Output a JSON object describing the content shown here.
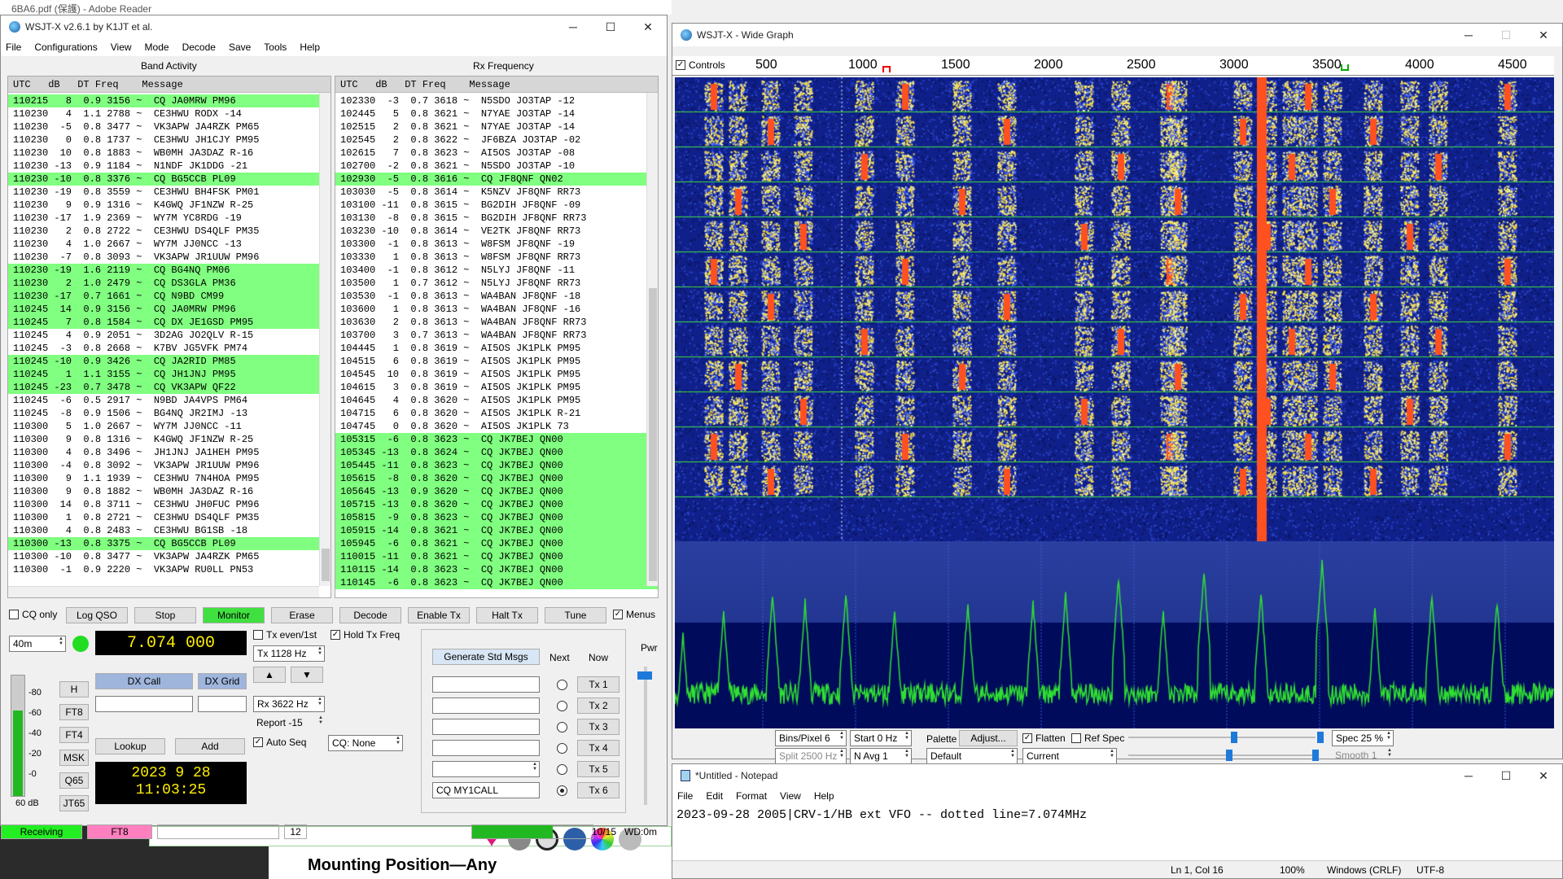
{
  "adobe": {
    "title": "6BA6.pdf (保護) - Adobe Reader",
    "pdf_text": "Mounting Position—Any"
  },
  "wsjtx": {
    "title": "WSJT-X   v2.6.1   by K1JT et al.",
    "menus": [
      "File",
      "Configurations",
      "View",
      "Mode",
      "Decode",
      "Save",
      "Tools",
      "Help"
    ],
    "band_activity_title": "Band Activity",
    "rx_frequency_title": "Rx Frequency",
    "col_header": "UTC   dB   DT Freq    Message",
    "band_activity_rows": [
      {
        "text": "110215   8  0.9 3156 ~  CQ JA0MRW PM96",
        "cq": true
      },
      {
        "text": "110230   4  1.1 2788 ~  CE3HWU RODX -14",
        "cq": false
      },
      {
        "text": "110230  -5  0.8 3477 ~  VK3APW JA4RZK PM65",
        "cq": false
      },
      {
        "text": "110230   0  0.8 1737 ~  CE3HWU JH1CJY PM95",
        "cq": false
      },
      {
        "text": "110230  10  0.8 1883 ~  WB0MH JA3DAZ R-16",
        "cq": false
      },
      {
        "text": "110230 -13  0.9 1184 ~  N1NDF JK1DDG -21",
        "cq": false
      },
      {
        "text": "110230 -10  0.8 3376 ~  CQ BG5CCB PL09",
        "cq": true
      },
      {
        "text": "110230 -19  0.8 3559 ~  CE3HWU BH4FSK PM01",
        "cq": false
      },
      {
        "text": "110230   9  0.9 1316 ~  K4GWQ JF1NZW R-25",
        "cq": false
      },
      {
        "text": "110230 -17  1.9 2369 ~  WY7M YC8RDG -19",
        "cq": false
      },
      {
        "text": "110230   2  0.8 2722 ~  CE3HWU DS4QLF PM35",
        "cq": false
      },
      {
        "text": "110230   4  1.0 2667 ~  WY7M JJ0NCC -13",
        "cq": false
      },
      {
        "text": "110230  -7  0.8 3093 ~  VK3APW JR1UUW PM96",
        "cq": false
      },
      {
        "text": "110230 -19  1.6 2119 ~  CQ BG4NQ PM06",
        "cq": true
      },
      {
        "text": "110230   2  1.0 2479 ~  CQ DS3GLA PM36",
        "cq": true
      },
      {
        "text": "110230 -17  0.7 1661 ~  CQ N9BD CM99",
        "cq": true
      },
      {
        "text": "110245  14  0.9 3156 ~  CQ JA0MRW PM96",
        "cq": true
      },
      {
        "text": "110245   7  0.8 1584 ~  CQ DX JE1GSD PM95",
        "cq": true
      },
      {
        "text": "110245   4  0.9 2051 ~  3D2AG JO2QLV R-15",
        "cq": false
      },
      {
        "text": "110245  -3  0.8 2668 ~  K7BV JG5VFK PM74",
        "cq": false
      },
      {
        "text": "110245 -10  0.9 3426 ~  CQ JA2RID PM85",
        "cq": true
      },
      {
        "text": "110245   1  1.1 3155 ~  CQ JH1JNJ PM95",
        "cq": true
      },
      {
        "text": "110245 -23  0.7 3478 ~  CQ VK3APW QF22",
        "cq": true
      },
      {
        "text": "110245  -6  0.5 2917 ~  N9BD JA4VPS PM64",
        "cq": false
      },
      {
        "text": "110245  -8  0.9 1506 ~  BG4NQ JR2IMJ -13",
        "cq": false
      },
      {
        "text": "110300   5  1.0 2667 ~  WY7M JJ0NCC -11",
        "cq": false
      },
      {
        "text": "110300   9  0.8 1316 ~  K4GWQ JF1NZW R-25",
        "cq": false
      },
      {
        "text": "110300   4  0.8 3496 ~  JH1JNJ JA1HEH PM95",
        "cq": false
      },
      {
        "text": "110300  -4  0.8 3092 ~  VK3APW JR1UUW PM96",
        "cq": false
      },
      {
        "text": "110300   9  1.1 1939 ~  CE3HWU 7N4HOA PM95",
        "cq": false
      },
      {
        "text": "110300   9  0.8 1882 ~  WB0MH JA3DAZ R-16",
        "cq": false
      },
      {
        "text": "110300  14  0.8 3711 ~  CE3HWU JH0FUC PM96",
        "cq": false
      },
      {
        "text": "110300   1  0.8 2721 ~  CE3HWU DS4QLF PM35",
        "cq": false
      },
      {
        "text": "110300   4  0.8 2483 ~  CE3HWU BG1SB -18",
        "cq": false
      },
      {
        "text": "110300 -13  0.8 3375 ~  CQ BG5CCB PL09",
        "cq": true
      },
      {
        "text": "110300 -10  0.8 3477 ~  VK3APW JA4RZK PM65",
        "cq": false
      },
      {
        "text": "110300  -1  0.9 2220 ~  VK3APW RU0LL PN53",
        "cq": false
      }
    ],
    "rx_rows": [
      {
        "text": "102330  -3  0.7 3618 ~  N5SDO JO3TAP -12",
        "cq": false
      },
      {
        "text": "102445   5  0.8 3621 ~  N7YAE JO3TAP -14",
        "cq": false
      },
      {
        "text": "102515   2  0.8 3621 ~  N7YAE JO3TAP -14",
        "cq": false
      },
      {
        "text": "102545   2  0.8 3622 ~  JF6BZA JO3TAP -02",
        "cq": false
      },
      {
        "text": "102615   7  0.8 3623 ~  AI5OS JO3TAP -08",
        "cq": false
      },
      {
        "text": "102700  -2  0.8 3621 ~  N5SDO JO3TAP -10",
        "cq": false
      },
      {
        "text": "102930  -5  0.8 3616 ~  CQ JF8QNF QN02",
        "cq": true
      },
      {
        "text": "103030  -5  0.8 3614 ~  K5NZV JF8QNF RR73",
        "cq": false
      },
      {
        "text": "103100 -11  0.8 3615 ~  BG2DIH JF8QNF -09",
        "cq": false
      },
      {
        "text": "103130  -8  0.8 3615 ~  BG2DIH JF8QNF RR73",
        "cq": false
      },
      {
        "text": "103230 -10  0.8 3614 ~  VE2TK JF8QNF RR73",
        "cq": false
      },
      {
        "text": "103300  -1  0.8 3613 ~  W8FSM JF8QNF -19",
        "cq": false
      },
      {
        "text": "103330   1  0.8 3613 ~  W8FSM JF8QNF RR73",
        "cq": false
      },
      {
        "text": "103400  -1  0.8 3612 ~  N5LYJ JF8QNF -11",
        "cq": false
      },
      {
        "text": "103500   1  0.7 3612 ~  N5LYJ JF8QNF RR73",
        "cq": false
      },
      {
        "text": "103530  -1  0.8 3613 ~  WA4BAN JF8QNF -18",
        "cq": false
      },
      {
        "text": "103600   1  0.8 3613 ~  WA4BAN JF8QNF -16",
        "cq": false
      },
      {
        "text": "103630   2  0.8 3613 ~  WA4BAN JF8QNF RR73",
        "cq": false
      },
      {
        "text": "103700   3  0.7 3613 ~  WA4BAN JF8QNF RR73",
        "cq": false
      },
      {
        "text": "104445   1  0.8 3619 ~  AI5OS JK1PLK PM95",
        "cq": false
      },
      {
        "text": "104515   6  0.8 3619 ~  AI5OS JK1PLK PM95",
        "cq": false
      },
      {
        "text": "104545  10  0.8 3619 ~  AI5OS JK1PLK PM95",
        "cq": false
      },
      {
        "text": "104615   3  0.8 3619 ~  AI5OS JK1PLK PM95",
        "cq": false
      },
      {
        "text": "104645   4  0.8 3620 ~  AI5OS JK1PLK PM95",
        "cq": false
      },
      {
        "text": "104715   6  0.8 3620 ~  AI5OS JK1PLK R-21",
        "cq": false
      },
      {
        "text": "104745   0  0.8 3620 ~  AI5OS JK1PLK 73",
        "cq": false
      },
      {
        "text": "105315  -6  0.8 3623 ~  CQ JK7BEJ QN00",
        "cq": true
      },
      {
        "text": "105345 -13  0.8 3624 ~  CQ JK7BEJ QN00",
        "cq": true
      },
      {
        "text": "105445 -11  0.8 3623 ~  CQ JK7BEJ QN00",
        "cq": true
      },
      {
        "text": "105615  -8  0.8 3620 ~  CQ JK7BEJ QN00",
        "cq": true
      },
      {
        "text": "105645 -13  0.9 3620 ~  CQ JK7BEJ QN00",
        "cq": true
      },
      {
        "text": "105715 -13  0.8 3620 ~  CQ JK7BEJ QN00",
        "cq": true
      },
      {
        "text": "105815  -9  0.8 3623 ~  CQ JK7BEJ QN00",
        "cq": true
      },
      {
        "text": "105915 -14  0.8 3621 ~  CQ JK7BEJ QN00",
        "cq": true
      },
      {
        "text": "105945  -6  0.8 3621 ~  CQ JK7BEJ QN00",
        "cq": true
      },
      {
        "text": "110015 -11  0.8 3621 ~  CQ JK7BEJ QN00",
        "cq": true
      },
      {
        "text": "110115 -14  0.8 3623 ~  CQ JK7BEJ QN00",
        "cq": true
      },
      {
        "text": "110145  -6  0.8 3623 ~  CQ JK7BEJ QN00",
        "cq": true
      }
    ],
    "controls": {
      "cq_only": "CQ only",
      "log_qso": "Log QSO",
      "stop": "Stop",
      "monitor": "Monitor",
      "erase": "Erase",
      "decode": "Decode",
      "enable_tx": "Enable Tx",
      "halt_tx": "Halt Tx",
      "tune": "Tune",
      "menus": "Menus",
      "band": "40m",
      "frequency": "7.074 000",
      "tx_even": "Tx even/1st",
      "hold_tx_freq": "Hold Tx Freq",
      "tx_hz": "Tx  1128  Hz",
      "rx_hz": "Rx  3622  Hz",
      "report": "Report  -15",
      "auto_seq": "Auto Seq",
      "cq_none": "CQ: None",
      "dx_call": "DX Call",
      "dx_grid": "DX Grid",
      "lookup": "Lookup",
      "add": "Add",
      "h": "H",
      "ft8": "FT8",
      "ft4": "FT4",
      "msk": "MSK",
      "q65": "Q65",
      "jt65": "JT65",
      "meter_labels": [
        "80",
        "60",
        "40",
        "20",
        "0"
      ],
      "meter_db": "60 dB",
      "date": "2023  9  28",
      "time": "11:03:25",
      "generate_std_msgs": "Generate Std Msgs",
      "next": "Next",
      "now": "Now",
      "tx_buttons": [
        "Tx 1",
        "Tx 2",
        "Tx 3",
        "Tx 4",
        "Tx 5",
        "Tx 6"
      ],
      "tx6_msg": "CQ MY1CALL",
      "pwr": "Pwr"
    },
    "status": {
      "receiving": "Receiving",
      "mode": "FT8",
      "count": "12",
      "progress": "10/15",
      "wd": "WD:0m",
      "progress_fraction": 0.67
    }
  },
  "widegraph": {
    "title": "WSJT-X - Wide Graph",
    "controls_label": "Controls",
    "ticks": [
      "500",
      "1000",
      "1500",
      "2000",
      "2500",
      "3000",
      "3500",
      "4000",
      "4500"
    ],
    "bins_pixel": "Bins/Pixel  6",
    "start": "Start  0 Hz",
    "palette": "Palette",
    "adjust": "Adjust...",
    "flatten": "Flatten",
    "ref_spec": "Ref Spec",
    "spec": "Spec  25 %",
    "split": "Split  2500  Hz",
    "navg": "N Avg  1",
    "default": "Default",
    "current": "Current",
    "smooth": "Smooth   1",
    "band_label": "40m"
  },
  "notepad": {
    "title": "*Untitled - Notepad",
    "menus": [
      "File",
      "Edit",
      "Format",
      "View",
      "Help"
    ],
    "text": "2023-09-28 2005|CRV-1/HB ext VFO  -- dotted line=7.074MHz",
    "position": "Ln 1, Col 16",
    "zoom": "100%",
    "eol": "Windows (CRLF)",
    "encoding": "UTF-8"
  }
}
